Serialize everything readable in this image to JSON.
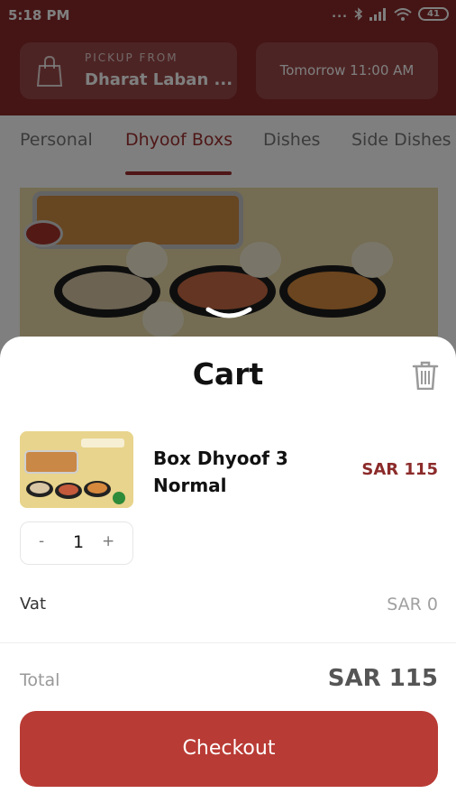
{
  "status_bar": {
    "time": "5:18 PM",
    "dots": "...",
    "battery": "41"
  },
  "header": {
    "pickup_label": "PICKUP FROM",
    "pickup_location": "Dharat Laban ...",
    "pickup_time": "Tomorrow 11:00 AM"
  },
  "tabs": [
    {
      "label": "Personal",
      "active": false
    },
    {
      "label": "Dhyoof Boxs",
      "active": true
    },
    {
      "label": "Dishes",
      "active": false
    },
    {
      "label": "Side Dishes",
      "active": false
    }
  ],
  "colors": {
    "brand": "#8b2b2a",
    "checkout": "#b93b35"
  },
  "icons": {
    "pickup": "shopping-bag-icon",
    "clear_cart": "trash-icon",
    "sheet_handle": "chevron-down-icon"
  },
  "cart": {
    "title": "Cart",
    "items": [
      {
        "name": "Box Dhyoof 3 Normal",
        "price": "SAR 115",
        "quantity": "1",
        "minus": "-",
        "plus": "+"
      }
    ],
    "vat_label": "Vat",
    "vat_value": "SAR 0",
    "total_label": "Total",
    "total_value": "SAR 115",
    "checkout_label": "Checkout"
  }
}
